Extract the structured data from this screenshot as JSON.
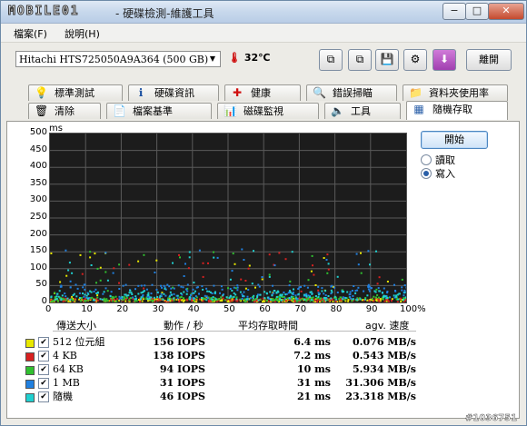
{
  "window": {
    "logo_text": "MOBILE01",
    "title": "- 硬碟檢測-維護工具",
    "controls": [
      "−",
      "□",
      "✕"
    ]
  },
  "menu": [
    "檔案(F)",
    "說明(H)"
  ],
  "toolbar": {
    "drive": "Hitachi HTS725050A9A364 (500 GB)",
    "temperature": "32℃",
    "exit_label": "離開"
  },
  "tabs_row1": [
    {
      "label": "標準測試",
      "icon": "lightbulb-icon",
      "glyph": "💡"
    },
    {
      "label": "硬碟資訊",
      "icon": "info-icon",
      "glyph": "ℹ"
    },
    {
      "label": "健康",
      "icon": "health-cross-icon",
      "glyph": "✚"
    },
    {
      "label": "錯誤掃瞄",
      "icon": "magnifier-icon",
      "glyph": "🔍"
    },
    {
      "label": "資料夾使用率",
      "icon": "folder-icon",
      "glyph": "📁"
    }
  ],
  "tabs_row2": [
    {
      "label": "清除",
      "icon": "trash-icon",
      "glyph": "🗑"
    },
    {
      "label": "檔案基準",
      "icon": "file-benchmark-icon",
      "glyph": "📄"
    },
    {
      "label": "磁碟監視",
      "icon": "disk-monitor-icon",
      "glyph": "📊"
    },
    {
      "label": "工具",
      "icon": "speaker-tools-icon",
      "glyph": "🔈"
    },
    {
      "label": "隨機存取",
      "icon": "random-access-icon",
      "glyph": "▦"
    }
  ],
  "controls": {
    "start_label": "開始",
    "options": [
      {
        "label": "讀取",
        "selected": false
      },
      {
        "label": "寫入",
        "selected": true
      }
    ]
  },
  "chart_data": {
    "type": "scatter",
    "ylabel": "ms",
    "yticks": [
      0,
      50,
      100,
      150,
      200,
      250,
      300,
      350,
      400,
      450,
      500
    ],
    "xticks": [
      "0",
      "10",
      "20",
      "30",
      "40",
      "50",
      "60",
      "70",
      "80",
      "90",
      "100%"
    ],
    "ylim": [
      0,
      500
    ],
    "xlim": [
      0,
      100
    ],
    "grid": true,
    "series": [
      {
        "name": "512 位元組",
        "color": "#e8e800",
        "typical_ms": 6.4
      },
      {
        "name": "4 KB",
        "color": "#d82020",
        "typical_ms": 7.2
      },
      {
        "name": "64 KB",
        "color": "#30c030",
        "typical_ms": 10
      },
      {
        "name": "1 MB",
        "color": "#2080e0",
        "typical_ms": 31
      },
      {
        "name": "隨機",
        "color": "#20d0d0",
        "typical_ms": 21
      }
    ]
  },
  "results": {
    "headers": [
      "傳送大小",
      "動作 / 秒",
      "平均存取時間",
      "agv. 速度"
    ],
    "rows": [
      {
        "label": "512 位元組",
        "color": "#e8e800",
        "iops": "156 IOPS",
        "access": "6.4 ms",
        "speed": "0.076 MB/s"
      },
      {
        "label": "4 KB",
        "color": "#d82020",
        "iops": "138 IOPS",
        "access": "7.2 ms",
        "speed": "0.543 MB/s"
      },
      {
        "label": "64 KB",
        "color": "#30c030",
        "iops": "94 IOPS",
        "access": "10 ms",
        "speed": "5.934 MB/s"
      },
      {
        "label": "1 MB",
        "color": "#2080e0",
        "iops": "31 IOPS",
        "access": "31 ms",
        "speed": "31.306 MB/s"
      },
      {
        "label": "隨機",
        "color": "#20d0d0",
        "iops": "46 IOPS",
        "access": "21 ms",
        "speed": "23.318 MB/s"
      }
    ]
  },
  "watermark": "#1036751"
}
